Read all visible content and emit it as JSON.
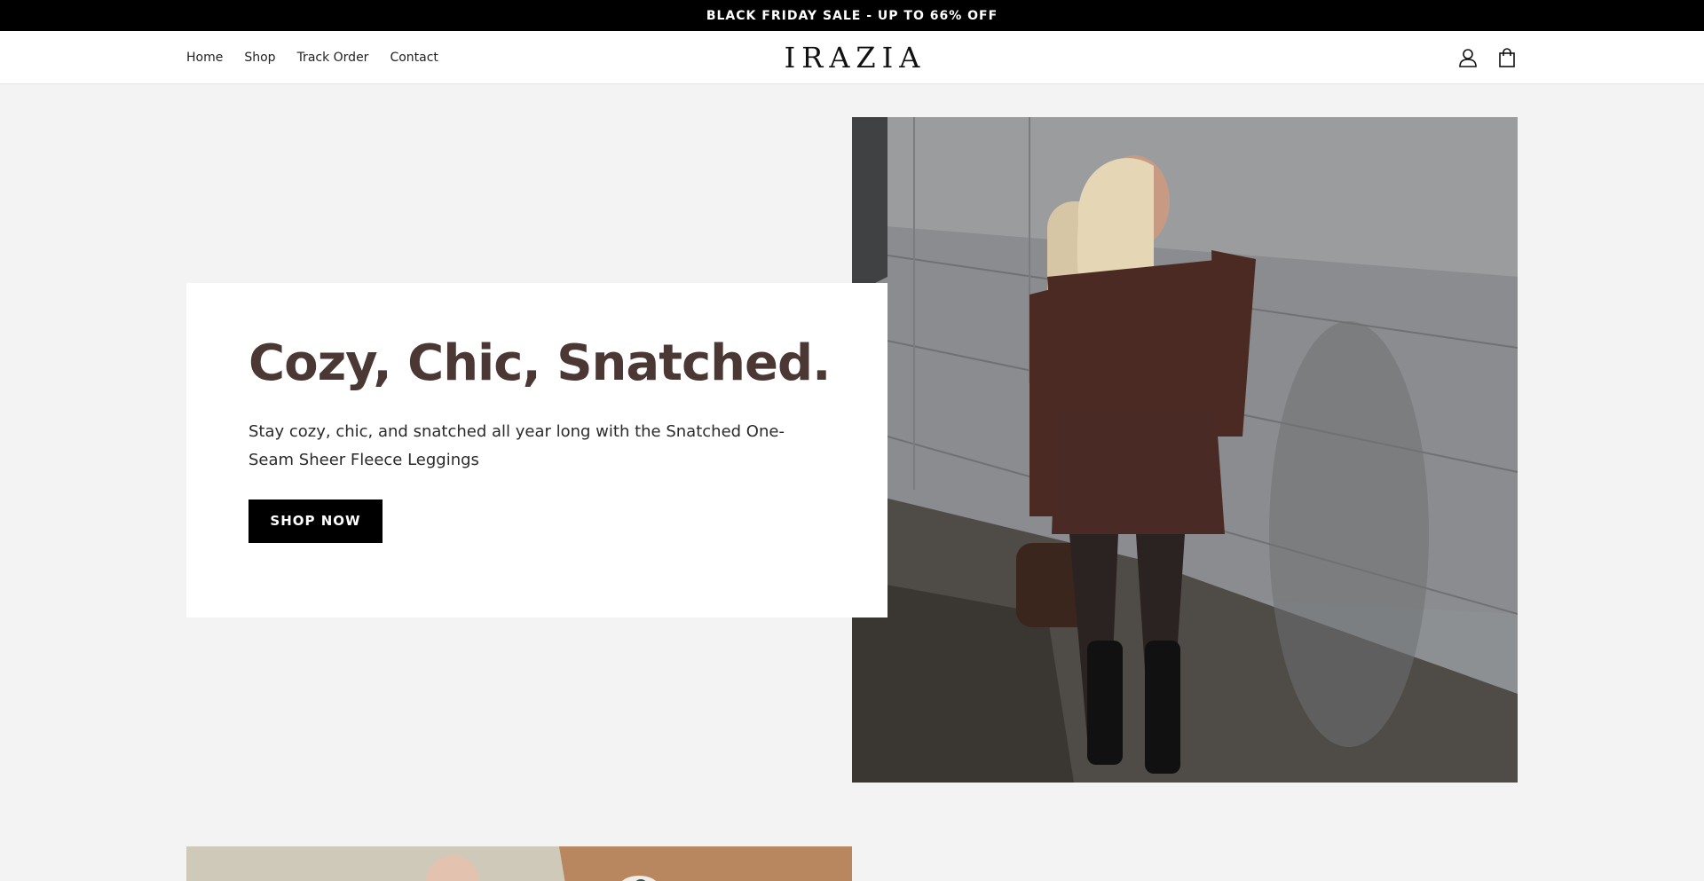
{
  "announcement": {
    "text": "BLACK FRIDAY SALE - UP TO 66% OFF"
  },
  "header": {
    "nav": [
      {
        "label": "Home"
      },
      {
        "label": "Shop"
      },
      {
        "label": "Track Order"
      },
      {
        "label": "Contact"
      }
    ],
    "logo": "IRAZIA",
    "icons": [
      "account-icon",
      "cart-icon"
    ]
  },
  "hero": {
    "title": "Cozy, Chic, Snatched.",
    "text": "Stay cozy, chic, and snatched all year long with the Snatched One-Seam Sheer Fleece Leggings",
    "button_label": "SHOP NOW",
    "accent_color": "#4b3835"
  }
}
